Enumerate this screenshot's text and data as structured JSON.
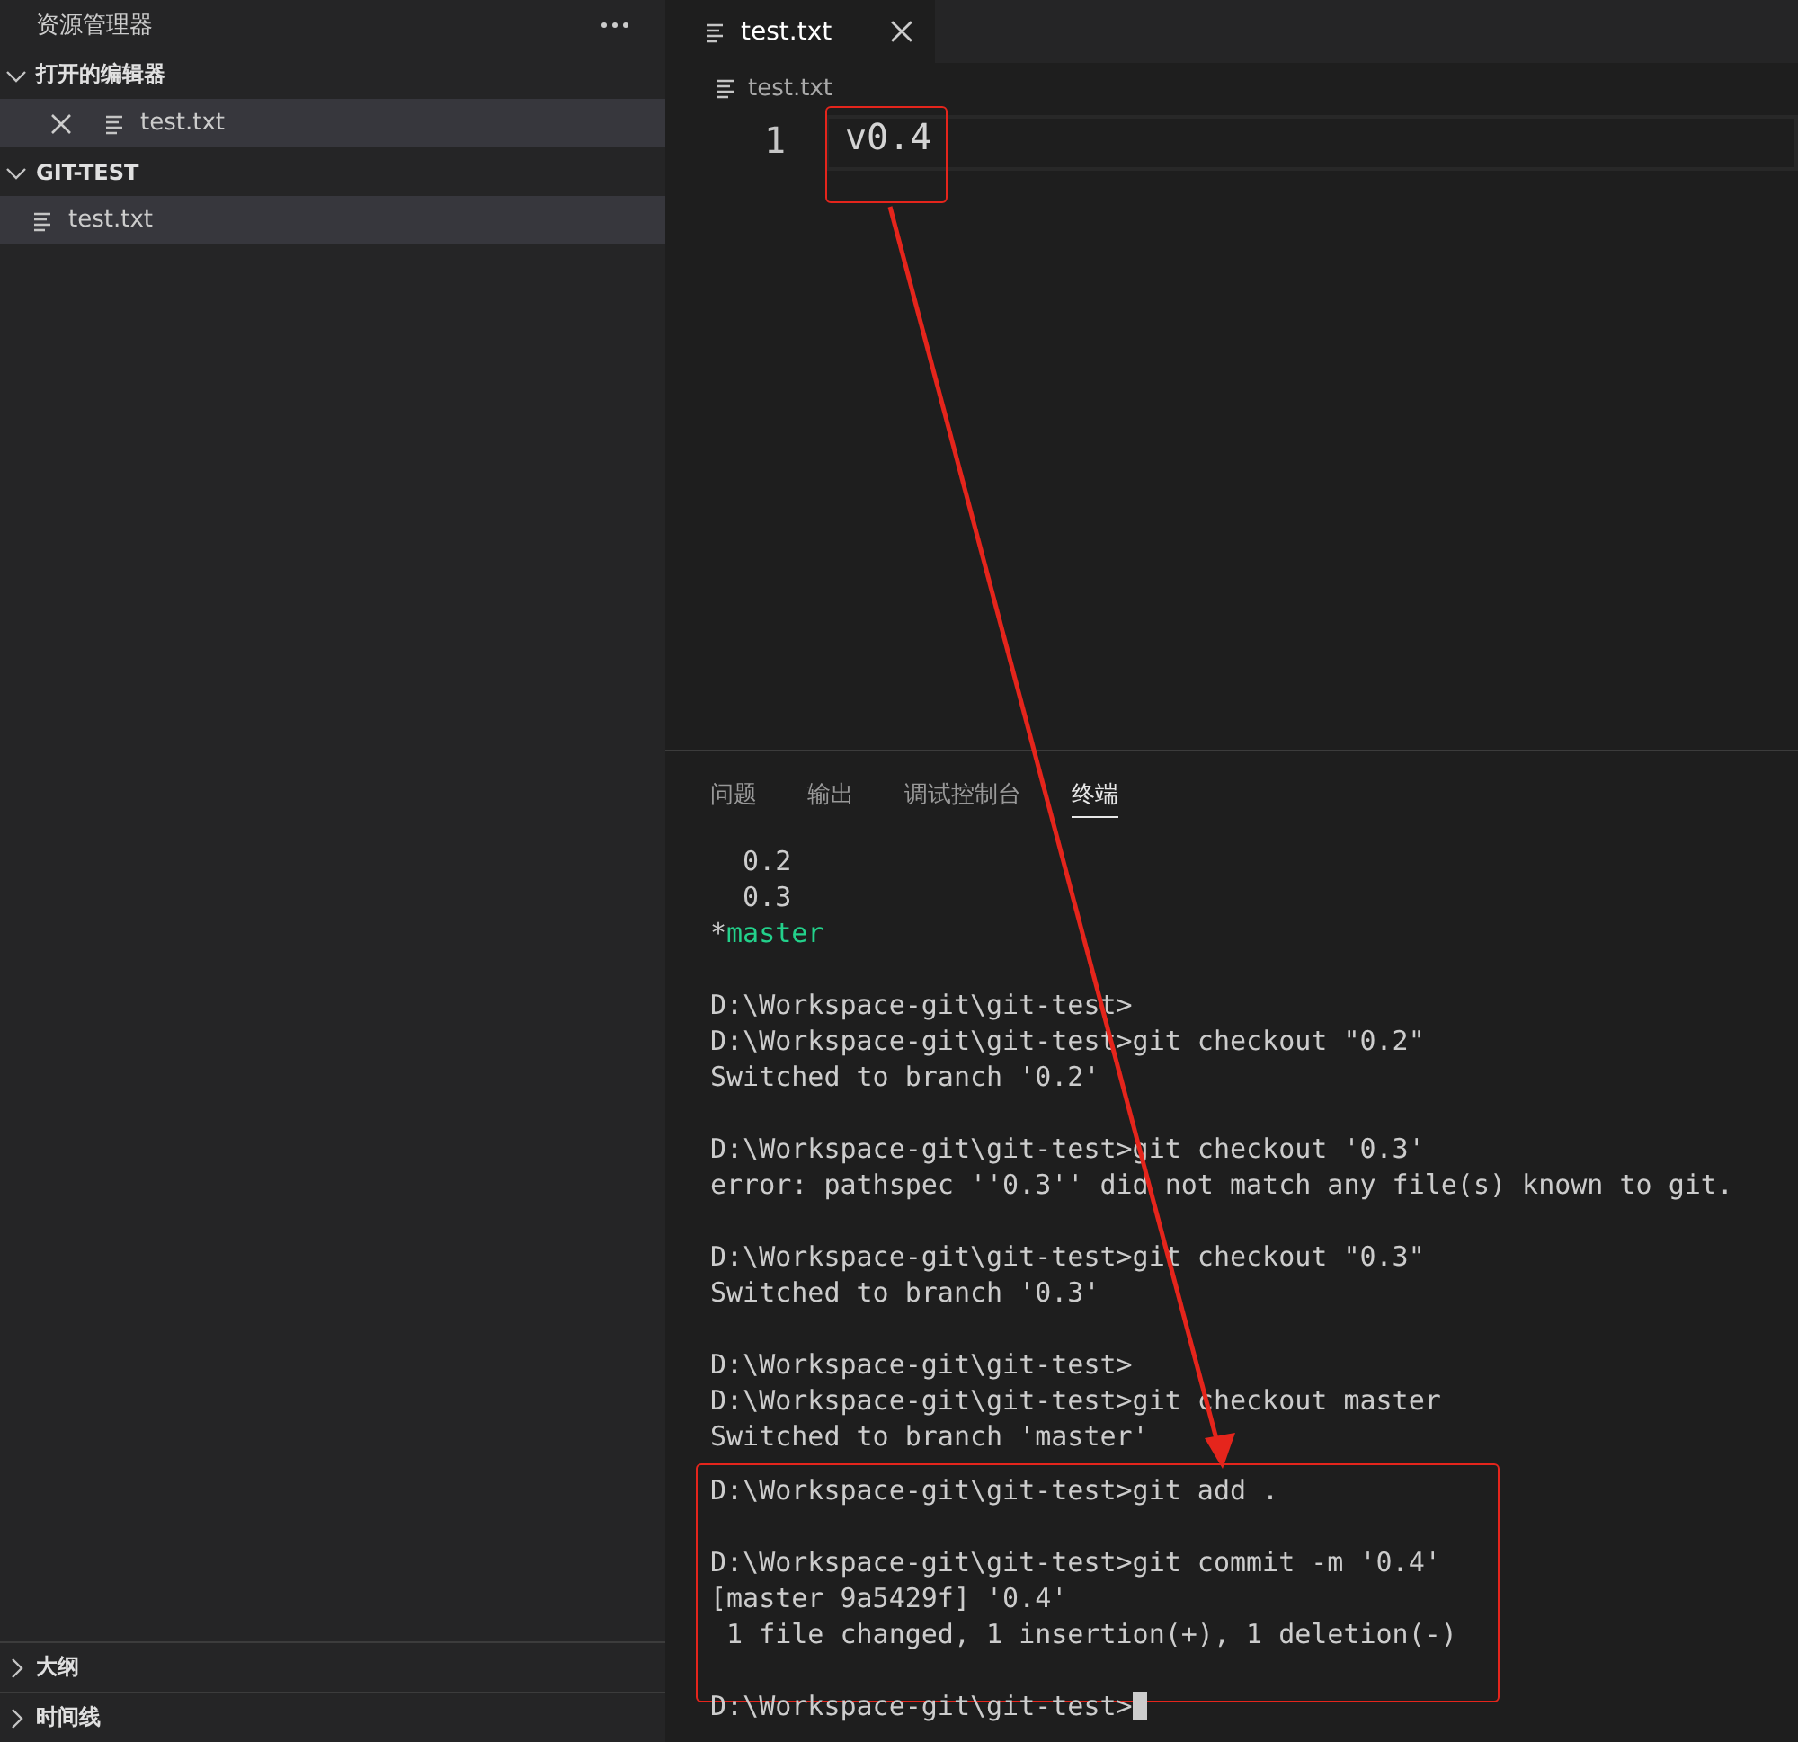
{
  "sidebar": {
    "title": "资源管理器",
    "sections": [
      {
        "title": "打开的编辑器",
        "expanded": true,
        "items": [
          {
            "label": "test.txt",
            "closable": true,
            "selected": true
          }
        ]
      },
      {
        "title": "GIT-TEST",
        "expanded": true,
        "items": [
          {
            "label": "test.txt",
            "closable": false,
            "selected": true
          }
        ]
      }
    ],
    "bottom_sections": [
      {
        "title": "大纲",
        "expanded": false
      },
      {
        "title": "时间线",
        "expanded": false
      }
    ]
  },
  "editor": {
    "tabs": [
      {
        "label": "test.txt",
        "selected": true
      }
    ],
    "breadcrumb": "test.txt",
    "lines": [
      {
        "number": "1",
        "text": "v0.4",
        "annotated": true
      }
    ]
  },
  "panel": {
    "tabs": [
      {
        "label": "问题",
        "selected": false
      },
      {
        "label": "输出",
        "selected": false
      },
      {
        "label": "调试控制台",
        "selected": false
      },
      {
        "label": "终端",
        "selected": true
      }
    ],
    "blocks": [
      [
        {
          "kind": "plain",
          "text": "  0.2"
        },
        {
          "kind": "plain",
          "text": "  0.3"
        },
        {
          "kind": "branch",
          "marker": "*",
          "text": "master"
        }
      ],
      [
        {
          "kind": "plain",
          "text": "D:\\Workspace-git\\git-test>"
        },
        {
          "kind": "plain",
          "text": "D:\\Workspace-git\\git-test>git checkout \"0.2\""
        },
        {
          "kind": "plain",
          "text": "Switched to branch '0.2'"
        }
      ],
      [
        {
          "kind": "plain",
          "text": "D:\\Workspace-git\\git-test>git checkout '0.3'"
        },
        {
          "kind": "plain",
          "text": "error: pathspec ''0.3'' did not match any file(s) known to git."
        }
      ],
      [
        {
          "kind": "plain",
          "text": "D:\\Workspace-git\\git-test>git checkout \"0.3\""
        },
        {
          "kind": "plain",
          "text": "Switched to branch '0.3'"
        }
      ],
      [
        {
          "kind": "plain",
          "text": "D:\\Workspace-git\\git-test>"
        },
        {
          "kind": "plain",
          "text": "D:\\Workspace-git\\git-test>git checkout master"
        },
        {
          "kind": "plain",
          "text": "Switched to branch 'master'"
        }
      ]
    ],
    "annotated_blocks": [
      [
        {
          "kind": "plain",
          "text": "D:\\Workspace-git\\git-test>git add ."
        }
      ],
      [
        {
          "kind": "plain",
          "text": "D:\\Workspace-git\\git-test>git commit -m '0.4'"
        },
        {
          "kind": "plain",
          "text": "[master 9a5429f] '0.4'"
        },
        {
          "kind": "plain",
          "text": " 1 file changed, 1 insertion(+), 1 deletion(-)"
        }
      ],
      [
        {
          "kind": "cursor",
          "text": "D:\\Workspace-git\\git-test>"
        }
      ]
    ]
  }
}
